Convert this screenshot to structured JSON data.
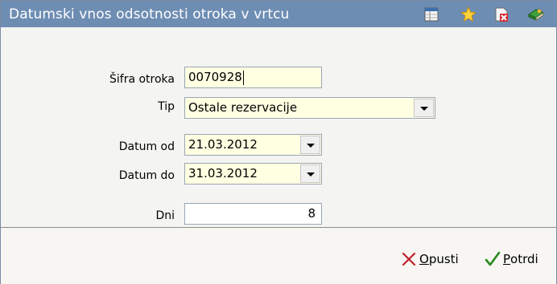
{
  "window": {
    "title": "Datumski vnos odsotnosti otroka v vrtcu"
  },
  "toolbar_icons": [
    "table-icon",
    "star-icon",
    "close-document-icon",
    "book-icon"
  ],
  "form": {
    "sifra_label": "Šifra otroka",
    "sifra_value": "0070928",
    "tip_label": "Tip",
    "tip_value": "Ostale rezervacije",
    "datum_od_label": "Datum od",
    "datum_od_value": "21.03.2012",
    "datum_do_label": "Datum do",
    "datum_do_value": "31.03.2012",
    "dni_label": "Dni",
    "dni_value": "8"
  },
  "buttons": {
    "opusti_first": "O",
    "opusti_rest": "pusti",
    "potrdi_first": "P",
    "potrdi_rest": "otrdi"
  },
  "colors": {
    "titlebar": "#6e8db3",
    "field_bg": "#ffffe2",
    "cancel": "#c0202a",
    "confirm": "#2a8a1c"
  }
}
